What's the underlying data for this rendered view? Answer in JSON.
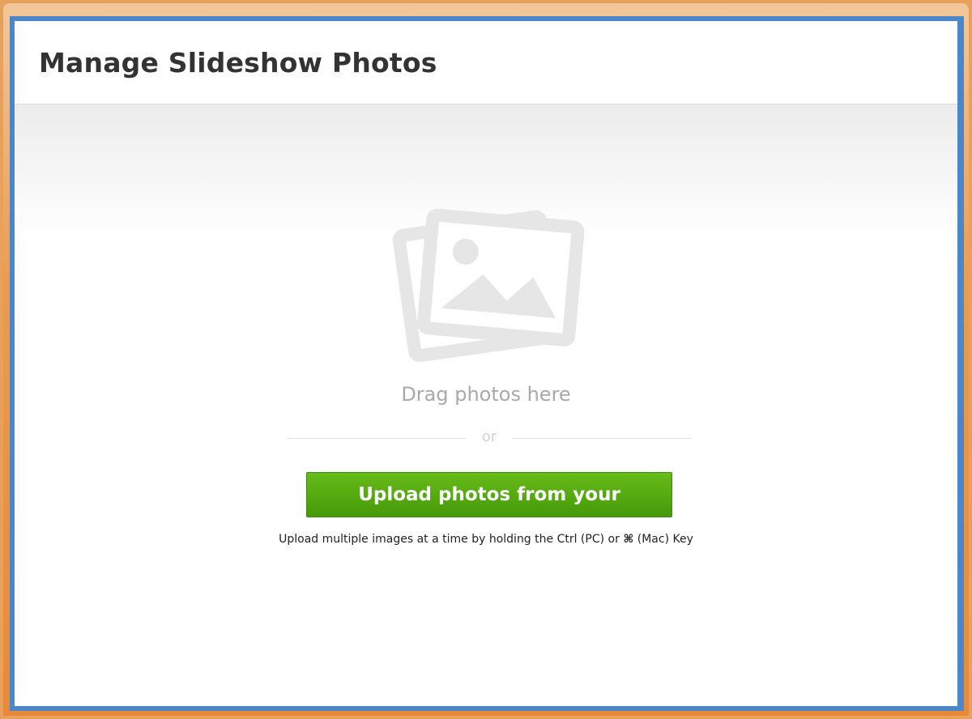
{
  "dialog": {
    "title": "Manage Slideshow Photos"
  },
  "drop_zone": {
    "icon": "photos-icon",
    "drag_text": "Drag photos here",
    "or_text": "or",
    "upload_button_label": "Upload photos from your computer",
    "hint_prefix": "Upload multiple images at a time by holding the Ctrl (PC) or",
    "hint_symbol": "⌘",
    "hint_suffix": "(Mac) Key"
  },
  "colors": {
    "frame_border": "#4a86c8",
    "outer_glow": "#e8893a",
    "button_green": "#54a90f",
    "title_text": "#333333",
    "muted_text": "#a9a9a9"
  }
}
